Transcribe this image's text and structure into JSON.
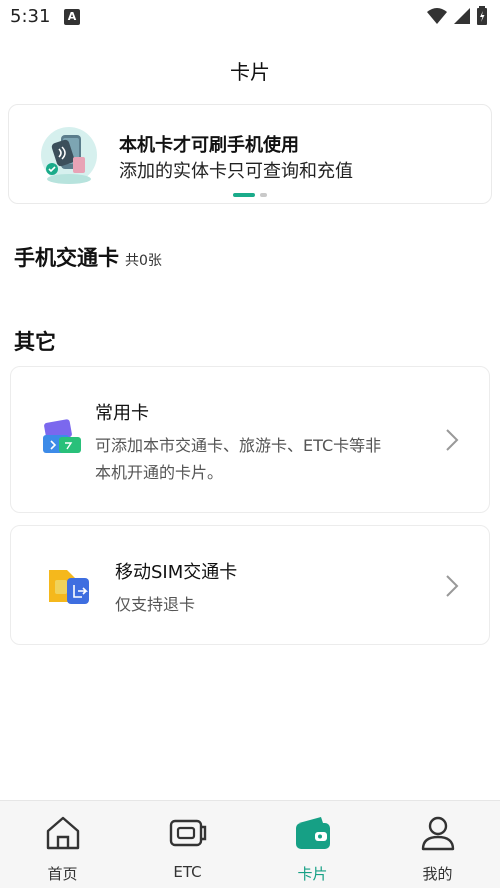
{
  "status_bar": {
    "time": "5:31"
  },
  "header": {
    "title": "卡片"
  },
  "banner": {
    "title": "本机卡才可刷手机使用",
    "subtitle": "添加的实体卡只可查询和充值",
    "slides_total": 2,
    "active_slide": 1
  },
  "phone_cards": {
    "title": "手机交通卡",
    "count": "共0张"
  },
  "others": {
    "title": "其它",
    "items": [
      {
        "title": "常用卡",
        "desc_line1": "可添加本市交通卡、旅游卡、ETC卡等非",
        "desc_line2": "本机开通的卡片。"
      },
      {
        "title": "移动SIM交通卡",
        "desc_line1": "仅支持退卡"
      }
    ]
  },
  "bottom_nav": {
    "items": [
      {
        "label": "首页",
        "icon": "home-icon"
      },
      {
        "label": "ETC",
        "icon": "etc-icon"
      },
      {
        "label": "卡片",
        "icon": "wallet-icon",
        "active": true
      },
      {
        "label": "我的",
        "icon": "person-icon"
      }
    ]
  },
  "colors": {
    "accent": "#16a085",
    "text": "#111111",
    "nav_bg": "#f6f6f6"
  }
}
